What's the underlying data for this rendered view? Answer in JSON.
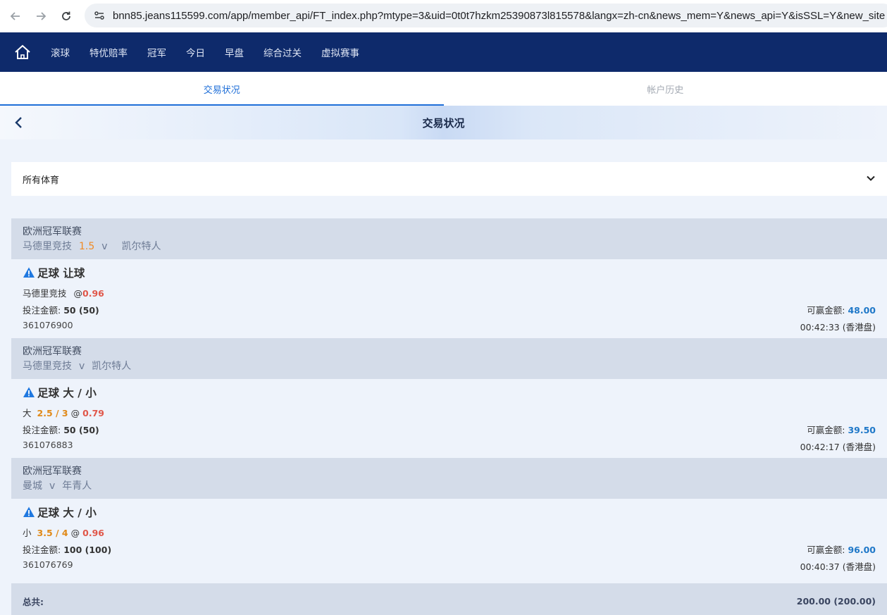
{
  "browser": {
    "url": "bnn85.jeans115599.com/app/member_api/FT_index.php?mtype=3&uid=0t0t7hzkm25390873l815578&langx=zh-cn&news_mem=Y&news_api=Y&isSSL=Y&new_site"
  },
  "nav": {
    "items": [
      "滚球",
      "特优赔率",
      "冠军",
      "今日",
      "早盘",
      "综合过关",
      "虚拟赛事"
    ]
  },
  "tabs": [
    {
      "label": "交易状况",
      "active": true
    },
    {
      "label": "帐户历史",
      "active": false
    }
  ],
  "subheader": {
    "title": "交易状况"
  },
  "filter": {
    "selected": "所有体育"
  },
  "bets": [
    {
      "league": "欧洲冠军联赛",
      "home": "马德里竞技",
      "handicap": "1.5",
      "vs": "v",
      "away": "凯尔特人",
      "bet_type": "足球 让球",
      "selection": "马德里竞技",
      "line": "",
      "at": "@",
      "odds": "0.96",
      "stake_label": "投注金额:",
      "stake": "50 (50)",
      "ticket": "361076900",
      "win_label": "可赢金额:",
      "win": "48.00",
      "time": "00:42:33 (香港盘)"
    },
    {
      "league": "欧洲冠军联赛",
      "home": "马德里竞技",
      "handicap": "",
      "vs": "v",
      "away": "凯尔特人",
      "bet_type": "足球 大 / 小",
      "selection": "大",
      "line": "2.5 / 3",
      "at": "@",
      "odds": "0.79",
      "stake_label": "投注金额:",
      "stake": "50 (50)",
      "ticket": "361076883",
      "win_label": "可赢金额:",
      "win": "39.50",
      "time": "00:42:17 (香港盘)"
    },
    {
      "league": "欧洲冠军联赛",
      "home": "曼城",
      "handicap": "",
      "vs": "v",
      "away": "年青人",
      "bet_type": "足球 大 / 小",
      "selection": "小",
      "line": "3.5 / 4",
      "at": "@",
      "odds": "0.96",
      "stake_label": "投注金额:",
      "stake": "100 (100)",
      "ticket": "361076769",
      "win_label": "可赢金额:",
      "win": "96.00",
      "time": "00:40:37 (香港盘)"
    }
  ],
  "total": {
    "label": "总共:",
    "value": "200.00 (200.00)"
  },
  "colors": {
    "nav_bg": "#0e2a6b",
    "accent": "#1f6fd8",
    "odds": "#e0574a",
    "line": "#e08a1a",
    "win": "#1f78c8"
  }
}
